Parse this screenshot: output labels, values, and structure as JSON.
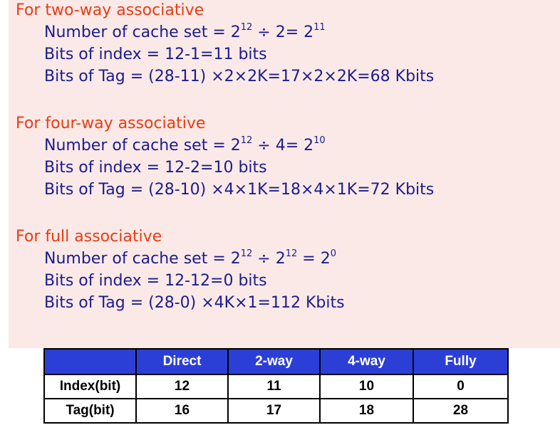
{
  "sections": [
    {
      "heading": "For two-way associative",
      "lines": [
        {
          "pre": "Number of cache set = 2",
          "s1": "12",
          "mid": " ÷ 2= 2",
          "s2": "11"
        },
        {
          "text": "Bits of index = 12-1=11 bits"
        },
        {
          "text": "Bits of Tag  = (28-11) ×2×2K=17×2×2K=68 Kbits"
        }
      ]
    },
    {
      "heading": "For four-way associative",
      "lines": [
        {
          "pre": "Number of cache set = 2",
          "s1": "12",
          "mid": " ÷ 4= 2",
          "s2": "10"
        },
        {
          "text": "Bits of index = 12-2=10 bits"
        },
        {
          "text": "Bits of Tag  = (28-10) ×4×1K=18×4×1K=72 Kbits"
        }
      ]
    },
    {
      "heading": "For full associative",
      "lines": [
        {
          "pre": "Number of cache set = 2",
          "s1": "12",
          "mid": " ÷ 2",
          "s2": "12",
          "mid2": " = 2",
          "s3": "0"
        },
        {
          "text": "Bits of index = 12-12=0 bits"
        },
        {
          "text": "Bits of Tag  = (28-0) ×4K×1=112 Kbits"
        }
      ]
    }
  ],
  "table": {
    "headers": [
      "",
      "Direct",
      "2-way",
      "4-way",
      "Fully"
    ],
    "rows": [
      [
        "Index(bit)",
        "12",
        "11",
        "10",
        "0"
      ],
      [
        "Tag(bit)",
        "16",
        "17",
        "18",
        "28"
      ]
    ]
  },
  "colors": {
    "heading": "#ea3b12",
    "body_text": "#1b1c8e",
    "panel_bg": "#fbe9e7",
    "table_header_bg": "#2b3fd6"
  }
}
